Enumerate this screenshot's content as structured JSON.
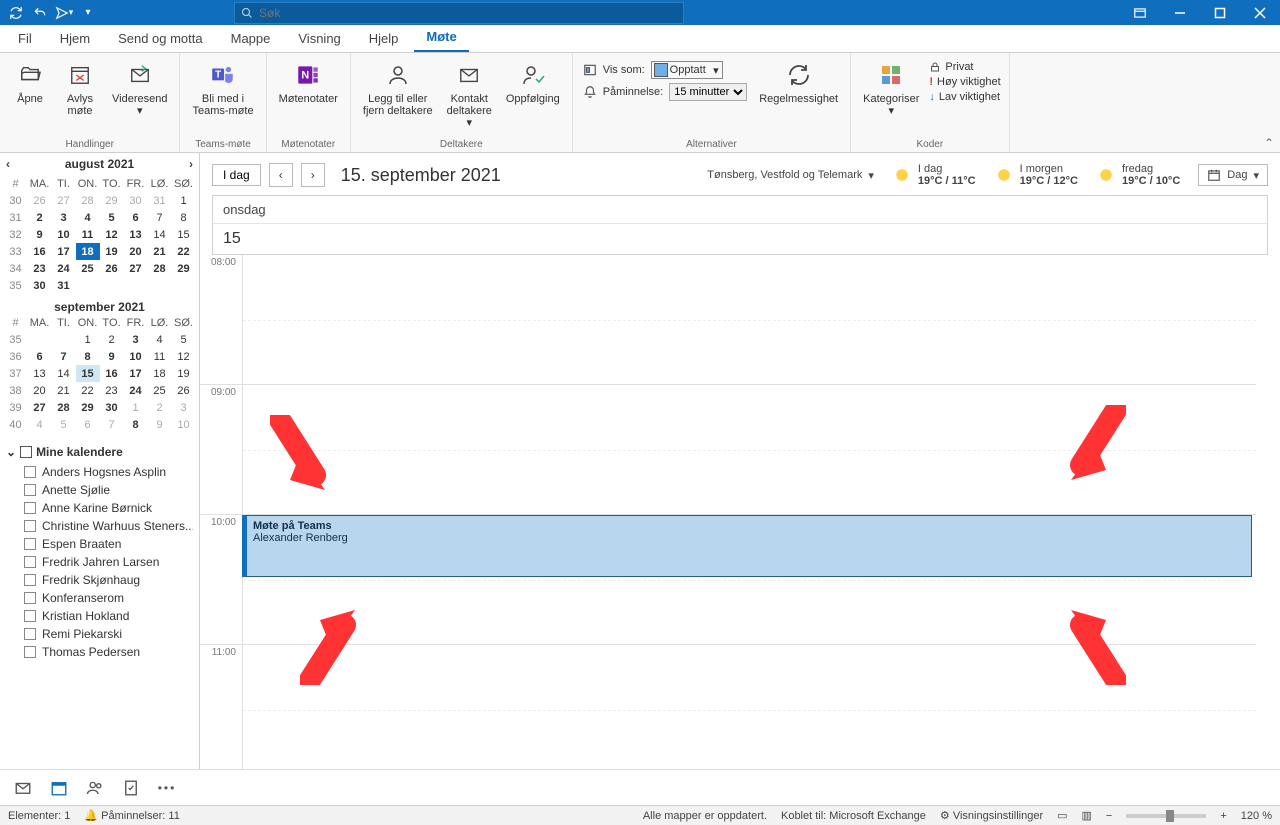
{
  "titlebar": {
    "search_placeholder": "Søk"
  },
  "tabs": {
    "fil": "Fil",
    "hjem": "Hjem",
    "sendmotta": "Send og motta",
    "mappe": "Mappe",
    "visning": "Visning",
    "hjelp": "Hjelp",
    "mote": "Møte"
  },
  "ribbon": {
    "handlinger": {
      "apne": "Åpne",
      "avlys": "Avlys\nmøte",
      "videresend": "Videresend",
      "group": "Handlinger"
    },
    "teams": {
      "blimed": "Bli med i\nTeams-møte",
      "group": "Teams-møte"
    },
    "notater": {
      "btn": "Møtenotater",
      "group": "Møtenotater"
    },
    "deltakere": {
      "leggtil": "Legg til eller\nfjern deltakere",
      "kontakt": "Kontakt\ndeltakere",
      "oppfolging": "Oppfølging",
      "group": "Deltakere"
    },
    "alternativer": {
      "vis_som_label": "Vis som:",
      "vis_som_value": "Opptatt",
      "paminnelse_label": "Påminnelse:",
      "paminnelse_value": "15 minutter",
      "regel": "Regelmessighet",
      "group": "Alternativer"
    },
    "koder": {
      "kategoriser": "Kategoriser",
      "privat": "Privat",
      "hoy": "Høy viktighet",
      "lav": "Lav viktighet",
      "group": "Koder"
    }
  },
  "calnav": {
    "idag": "I dag",
    "current_date": "15. september 2021",
    "location": "Tønsberg, Vestfold og Telemark",
    "w1_label": "I dag",
    "w1_temp": "19°C / 11°C",
    "w2_label": "I morgen",
    "w2_temp": "19°C / 12°C",
    "w3_label": "fredag",
    "w3_temp": "19°C / 10°C",
    "viewbtn": "Dag"
  },
  "dayheader": {
    "weekday": "onsdag",
    "daynum": "15"
  },
  "hours": {
    "h8": "08:00",
    "h9": "09:00",
    "h10": "10:00",
    "h11": "11:00"
  },
  "appt": {
    "title": "Møte på Teams",
    "who": "Alexander Renberg"
  },
  "mini1": {
    "title": "august 2021",
    "head": [
      "#",
      "MA.",
      "TI.",
      "ON.",
      "TO.",
      "FR.",
      "LØ.",
      "SØ."
    ],
    "rows": [
      {
        "wk": "30",
        "d": [
          "26",
          "27",
          "28",
          "29",
          "30",
          "31",
          "1"
        ],
        "dim": [
          0,
          1,
          2,
          3,
          4,
          5
        ]
      },
      {
        "wk": "31",
        "d": [
          "2",
          "3",
          "4",
          "5",
          "6",
          "7",
          "8"
        ],
        "bold": [
          0,
          1,
          2,
          3,
          4
        ]
      },
      {
        "wk": "32",
        "d": [
          "9",
          "10",
          "11",
          "12",
          "13",
          "14",
          "15"
        ],
        "bold": [
          0,
          1,
          2,
          3,
          4
        ]
      },
      {
        "wk": "33",
        "d": [
          "16",
          "17",
          "18",
          "19",
          "20",
          "21",
          "22"
        ],
        "bold": [
          0,
          1,
          2,
          3,
          4,
          5,
          6
        ],
        "today": 2
      },
      {
        "wk": "34",
        "d": [
          "23",
          "24",
          "25",
          "26",
          "27",
          "28",
          "29"
        ],
        "bold": [
          0,
          1,
          2,
          3,
          4,
          5,
          6
        ]
      },
      {
        "wk": "35",
        "d": [
          "30",
          "31",
          "",
          "",
          "",
          "",
          ""
        ],
        "bold": [
          0,
          1
        ]
      }
    ]
  },
  "mini2": {
    "title": "september 2021",
    "head": [
      "#",
      "MA.",
      "TI.",
      "ON.",
      "TO.",
      "FR.",
      "LØ.",
      "SØ."
    ],
    "rows": [
      {
        "wk": "35",
        "d": [
          "",
          "",
          "1",
          "2",
          "3",
          "4",
          "5"
        ],
        "bold": [
          4
        ]
      },
      {
        "wk": "36",
        "d": [
          "6",
          "7",
          "8",
          "9",
          "10",
          "11",
          "12"
        ],
        "bold": [
          0,
          1,
          2,
          3,
          4
        ]
      },
      {
        "wk": "37",
        "d": [
          "13",
          "14",
          "15",
          "16",
          "17",
          "18",
          "19"
        ],
        "bold": [
          2,
          3,
          4
        ],
        "sel": 2
      },
      {
        "wk": "38",
        "d": [
          "20",
          "21",
          "22",
          "23",
          "24",
          "25",
          "26"
        ],
        "bold": [
          4
        ]
      },
      {
        "wk": "39",
        "d": [
          "27",
          "28",
          "29",
          "30",
          "1",
          "2",
          "3"
        ],
        "bold": [
          0,
          1,
          2,
          3
        ],
        "dim": [
          4,
          5,
          6
        ]
      },
      {
        "wk": "40",
        "d": [
          "4",
          "5",
          "6",
          "7",
          "8",
          "9",
          "10"
        ],
        "dim": [
          0,
          1,
          2,
          3,
          5,
          6
        ],
        "bold": [
          4
        ]
      }
    ]
  },
  "calendars": {
    "header": "Mine kalendere",
    "items": [
      "Anders Hogsnes Asplin",
      "Anette Sjølie",
      "Anne Karine Børnick",
      "Christine Warhuus Steners...",
      "Espen Braaten",
      "Fredrik Jahren Larsen",
      "Fredrik Skjønhaug",
      "Konferanserom",
      "Kristian Hokland",
      "Remi Piekarski",
      "Thomas Pedersen"
    ]
  },
  "status": {
    "elements": "Elementer: 1",
    "paminnelser": "Påminnelser: 11",
    "mapper": "Alle mapper er oppdatert.",
    "koblet": "Koblet til: Microsoft Exchange",
    "visning": "Visningsinstillinger",
    "zoom": "120 %"
  }
}
